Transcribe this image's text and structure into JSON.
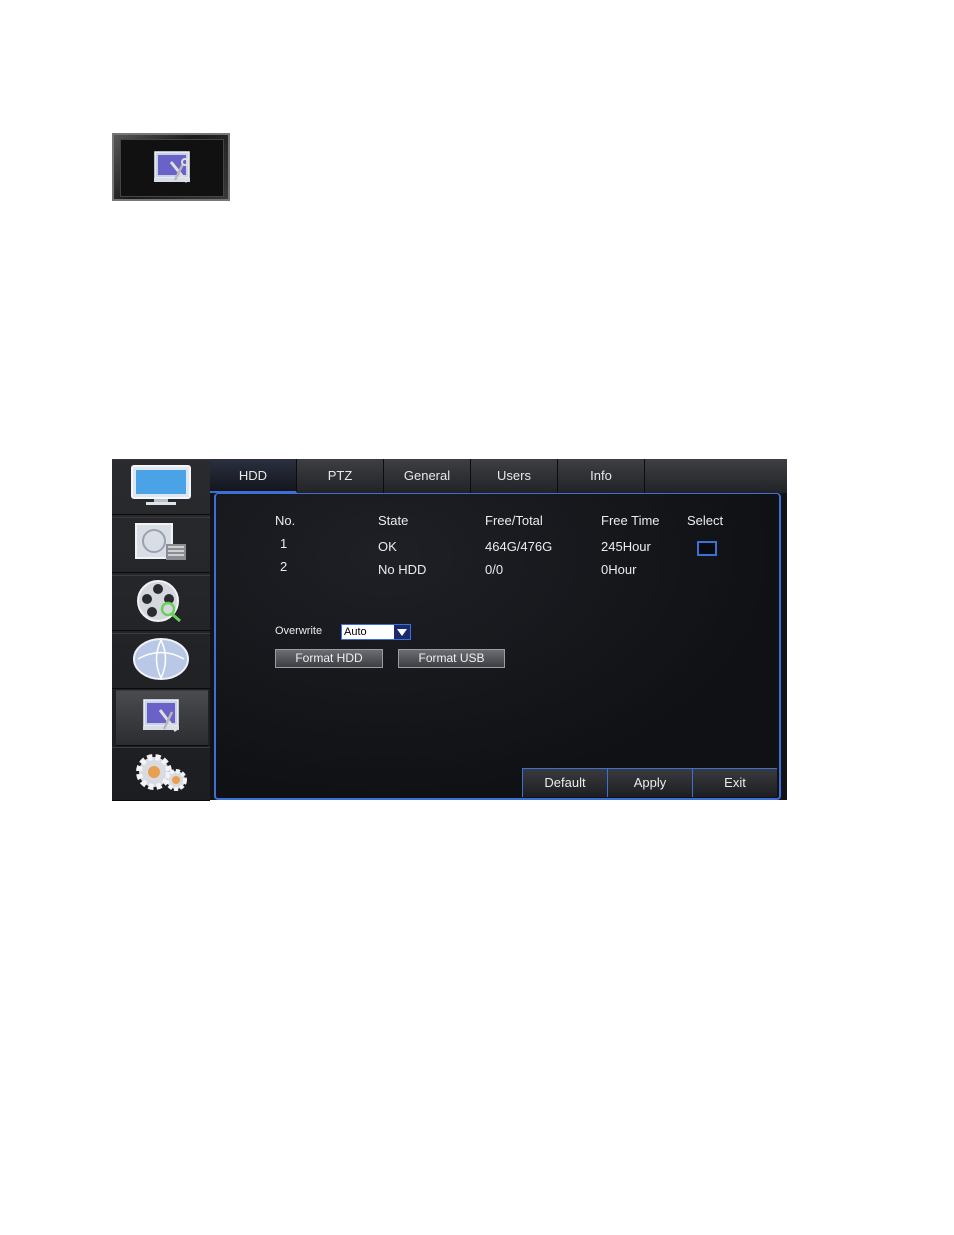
{
  "icons": {
    "top": "system-tools-icon",
    "sidebar": [
      "display-icon",
      "record-icon",
      "search-playback-icon",
      "network-icon",
      "system-tools-icon",
      "settings-gears-icon"
    ]
  },
  "tabs": [
    {
      "label": "HDD",
      "active": true
    },
    {
      "label": "PTZ"
    },
    {
      "label": "General"
    },
    {
      "label": "Users"
    },
    {
      "label": "Info"
    }
  ],
  "table": {
    "headers": [
      "No.",
      "State",
      "Free/Total",
      "Free Time",
      "Select"
    ],
    "rows": [
      [
        "1",
        "OK",
        "464G/476G",
        "245Hour"
      ],
      [
        "2",
        "No HDD",
        "0/0",
        "0Hour"
      ]
    ]
  },
  "overwrite": {
    "label": "Overwrite",
    "value": "Auto"
  },
  "buttons": {
    "format_hdd": "Format HDD",
    "format_usb": "Format USB"
  },
  "footer": {
    "default": "Default",
    "apply": "Apply",
    "exit": "Exit"
  },
  "colors": {
    "accent": "#3d6fd6",
    "background": "#121316"
  }
}
